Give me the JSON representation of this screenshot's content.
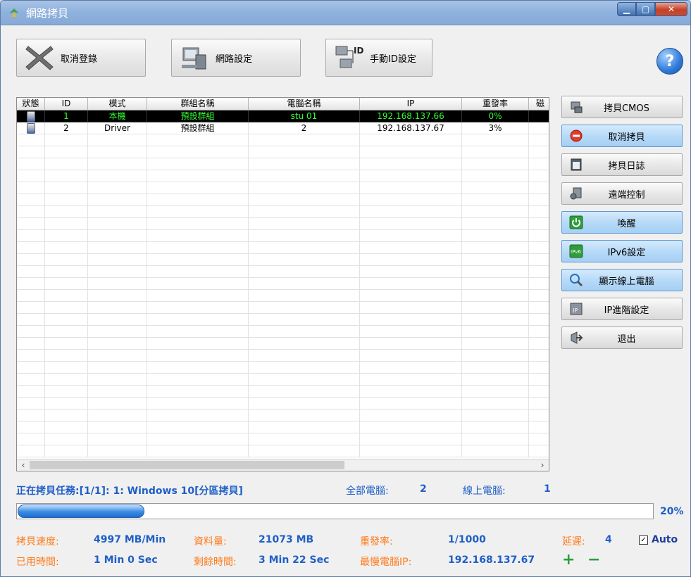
{
  "window": {
    "title": "網路拷貝"
  },
  "toolbar": {
    "cancel_register": "取消登錄",
    "network_settings": "網路設定",
    "manual_id": "手動ID設定",
    "help_symbol": "?"
  },
  "table": {
    "columns": [
      "狀態",
      "ID",
      "模式",
      "群組名稱",
      "電腦名稱",
      "IP",
      "重發率",
      "磁"
    ],
    "rows": [
      {
        "id": "1",
        "mode": "本機",
        "group": "預設群組",
        "computer": "stu 01",
        "ip": "192.168.137.66",
        "resend": "0%",
        "extra": ""
      },
      {
        "id": "2",
        "mode": "Driver",
        "group": "預設群組",
        "computer": "2",
        "ip": "192.168.137.67",
        "resend": "3%",
        "extra": ""
      }
    ]
  },
  "side": {
    "copy_cmos": "拷貝CMOS",
    "cancel_copy": "取消拷貝",
    "copy_log": "拷貝日誌",
    "remote_control": "遠端控制",
    "wake": "喚醒",
    "ipv6": "IPv6設定",
    "show_online": "顯示線上電腦",
    "ip_advanced": "IP進階設定",
    "exit": "退出"
  },
  "status": {
    "task": "正在拷貝任務:[1/1]: 1: Windows 10[分區拷貝]",
    "all_pc_label": "全部電腦:",
    "all_pc_value": "2",
    "online_label": "線上電腦:",
    "online_value": "1",
    "progress_text": "20%",
    "progress_fraction": 0.2,
    "speed_label": "拷貝速度:",
    "speed_value": "4997 MB/Min",
    "data_label": "資料量:",
    "data_value": "21073 MB",
    "resend_label": "重發率:",
    "resend_value": "1/1000",
    "delay_label": "延遲:",
    "delay_value": "4",
    "auto_label": "Auto",
    "elapsed_label": "已用時間:",
    "elapsed_value": "1 Min 0 Sec",
    "remain_label": "剩餘時間:",
    "remain_value": "3 Min 22 Sec",
    "slowest_label": "最慢電腦IP:",
    "slowest_value": "192.168.137.67",
    "plus": "+",
    "minus": "−"
  }
}
